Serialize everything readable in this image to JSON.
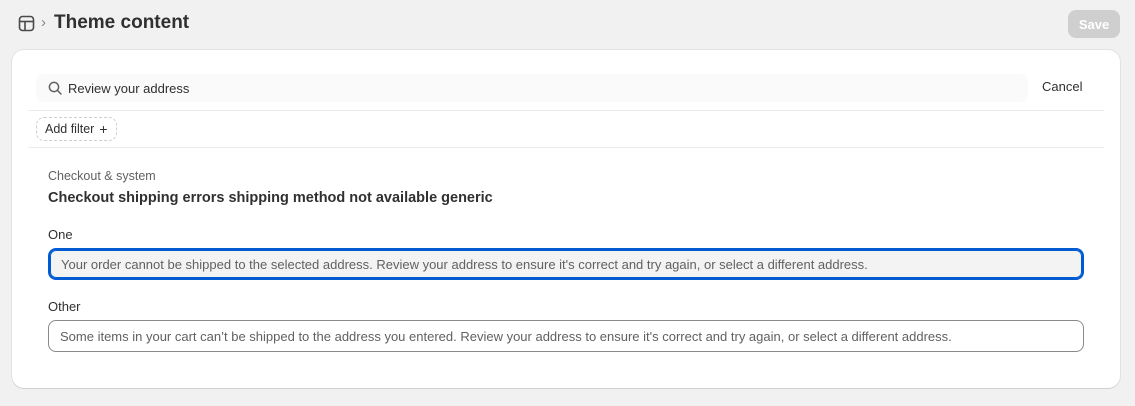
{
  "header": {
    "title": "Theme content",
    "separator": "›",
    "save_label": "Save",
    "icon": "layout-icon"
  },
  "search": {
    "value": "Review your address",
    "icon": "search-icon",
    "cancel_label": "Cancel"
  },
  "filter": {
    "add_label": "Add filter",
    "plus": "+"
  },
  "result": {
    "section": "Checkout & system",
    "title": "Checkout shipping errors shipping method not available generic",
    "fields": [
      {
        "label": "One",
        "value": "Your order cannot be shipped to the selected address. Review your address to ensure it's correct and try again, or select a different address."
      },
      {
        "label": "Other",
        "value": "Some items in your cart can’t be shipped to the address you entered. Review your address to ensure it's correct and try again, or select a different address."
      }
    ]
  },
  "colors": {
    "focus_ring": "#005bd3",
    "disabled_button": "#cfcfcf",
    "page_bg": "#f1f1f1"
  }
}
